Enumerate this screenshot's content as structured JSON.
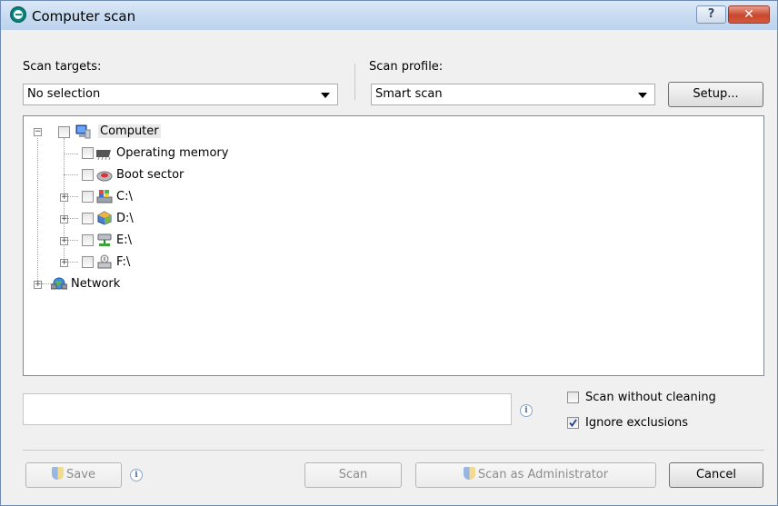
{
  "window": {
    "title": "Computer scan",
    "help_label": "?",
    "close_label": "✕"
  },
  "scan_targets": {
    "label": "Scan targets:",
    "value": "No selection"
  },
  "scan_profile": {
    "label": "Scan profile:",
    "value": "Smart scan"
  },
  "setup_label": "Setup...",
  "tree": {
    "computer": "Computer",
    "operating_memory": "Operating memory",
    "boot_sector": "Boot sector",
    "drive_c": "C:\\",
    "drive_d": "D:\\",
    "drive_e": "E:\\",
    "drive_f": "F:\\",
    "network": "Network"
  },
  "path_input": {
    "value": "",
    "placeholder": ""
  },
  "options": {
    "scan_without_cleaning": {
      "label": "Scan without cleaning",
      "checked": false
    },
    "ignore_exclusions": {
      "label": "Ignore exclusions",
      "checked": true
    }
  },
  "footer": {
    "save": "Save",
    "scan": "Scan",
    "scan_as_admin": "Scan as Administrator",
    "cancel": "Cancel"
  }
}
